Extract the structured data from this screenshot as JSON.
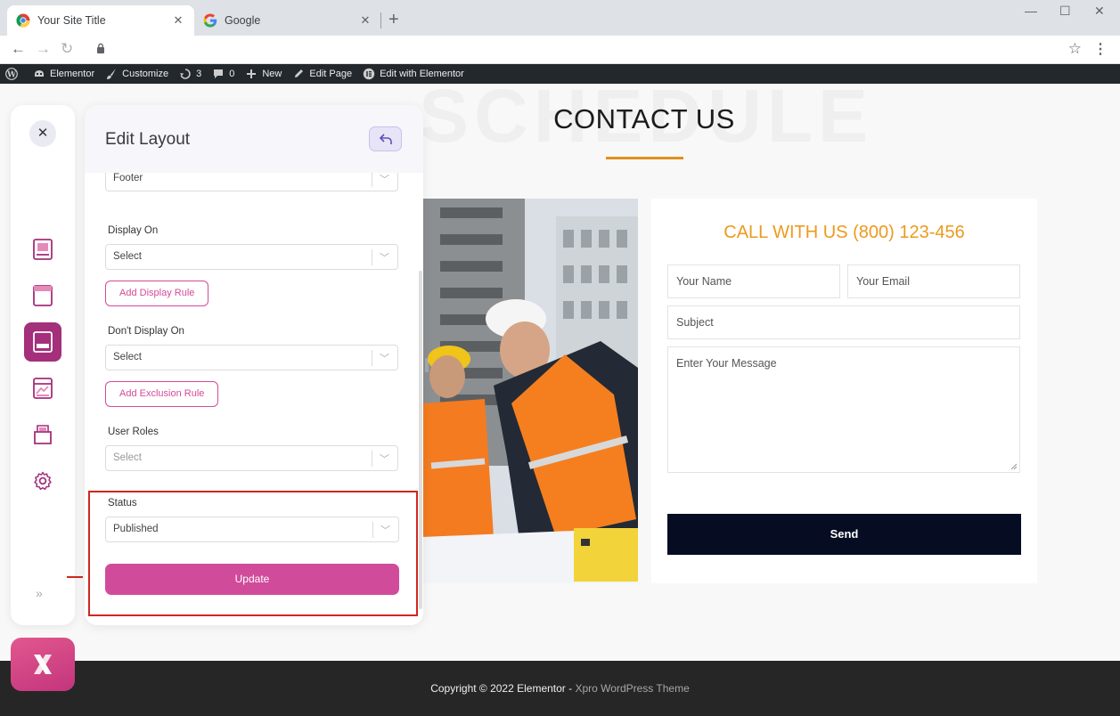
{
  "browser": {
    "tabs": [
      {
        "title": "Your Site Title",
        "active": true
      },
      {
        "title": "Google",
        "active": false
      }
    ],
    "new_tab": "+",
    "window_controls": {
      "minimize": "—",
      "maximize": "☐",
      "close": "✕"
    },
    "nav": {
      "back": "←",
      "forward": "→",
      "reload": "↻"
    },
    "star": "☆",
    "menu": "⋮"
  },
  "adminbar": {
    "items": [
      {
        "icon": "wordpress-icon",
        "label": ""
      },
      {
        "icon": "elementor-icon",
        "label": "Elementor"
      },
      {
        "icon": "brush-icon",
        "label": "Customize"
      },
      {
        "icon": "updates-icon",
        "label": "3"
      },
      {
        "icon": "comment-icon",
        "label": "0"
      },
      {
        "icon": "plus-icon",
        "label": "New"
      },
      {
        "icon": "pencil-icon",
        "label": "Edit Page"
      },
      {
        "icon": "elementor-e-icon",
        "label": "Edit with Elementor"
      }
    ]
  },
  "page": {
    "watermark": "SCHEDULE",
    "title": "CONTACT US",
    "accent_color": "#e08f1c"
  },
  "contact_form": {
    "heading": "CALL WITH US (800) 123-456",
    "heading_color": "#ec9a1d",
    "name_placeholder": "Your Name",
    "email_placeholder": "Your Email",
    "subject_placeholder": "Subject",
    "message_placeholder": "Enter Your Message",
    "send_label": "Send"
  },
  "footer": {
    "copyright": "Copyright © 2022 Elementor - ",
    "theme": "Xpro WordPress Theme"
  },
  "rail": {
    "close": "✕",
    "icons": [
      "header-layout-icon",
      "page-layout-icon",
      "footer-layout-icon",
      "archive-layout-icon",
      "single-post-icon",
      "settings-gear-icon"
    ],
    "active_icon": "footer-layout-icon",
    "more": "»"
  },
  "panel": {
    "title": "Edit Layout",
    "type_value": "Footer",
    "display_on": {
      "label": "Display On",
      "value": "Select"
    },
    "add_display_rule": "Add Display Rule",
    "dont_display_on": {
      "label": "Don't Display On",
      "value": "Select"
    },
    "add_exclusion_rule": "Add Exclusion Rule",
    "user_roles": {
      "label": "User Roles",
      "value": "Select"
    },
    "status": {
      "label": "Status",
      "value": "Published"
    },
    "update_label": "Update",
    "brand_color": "#d14b9b"
  }
}
